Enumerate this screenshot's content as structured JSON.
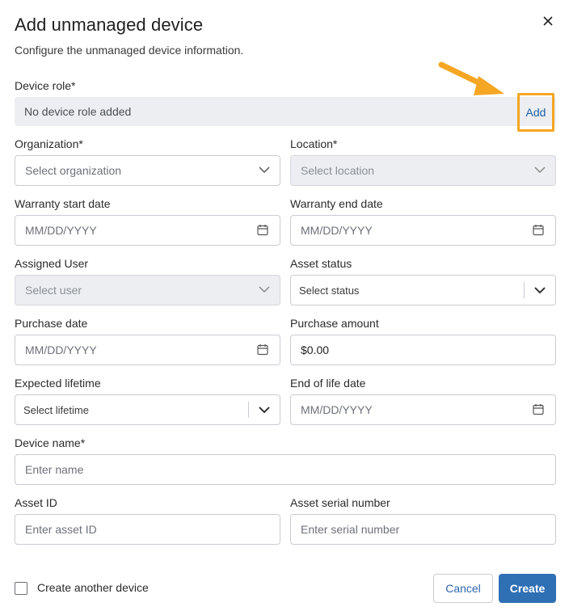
{
  "dialog": {
    "title": "Add unmanaged device",
    "subtitle": "Configure the unmanaged device information."
  },
  "device_role": {
    "label": "Device role*",
    "empty_text": "No device role added",
    "add_label": "Add"
  },
  "organization": {
    "label": "Organization*",
    "placeholder": "Select organization"
  },
  "location": {
    "label": "Location*",
    "placeholder": "Select location"
  },
  "warranty_start": {
    "label": "Warranty start date",
    "placeholder": "MM/DD/YYYY"
  },
  "warranty_end": {
    "label": "Warranty end date",
    "placeholder": "MM/DD/YYYY"
  },
  "assigned_user": {
    "label": "Assigned User",
    "placeholder": "Select user"
  },
  "asset_status": {
    "label": "Asset status",
    "placeholder": "Select status"
  },
  "purchase_date": {
    "label": "Purchase date",
    "placeholder": "MM/DD/YYYY"
  },
  "purchase_amount": {
    "label": "Purchase amount",
    "value": "$0.00"
  },
  "expected_lifetime": {
    "label": "Expected lifetime",
    "placeholder": "Select lifetime"
  },
  "end_of_life": {
    "label": "End of life date",
    "placeholder": "MM/DD/YYYY"
  },
  "device_name": {
    "label": "Device name*",
    "placeholder": "Enter name"
  },
  "asset_id": {
    "label": "Asset ID",
    "placeholder": "Enter asset ID"
  },
  "serial_number": {
    "label": "Asset serial number",
    "placeholder": "Enter serial number"
  },
  "footer": {
    "create_another_label": "Create another device",
    "cancel_label": "Cancel",
    "create_label": "Create"
  },
  "icons": {
    "close": "close-icon",
    "chevron": "chevron-down-icon",
    "calendar": "calendar-icon",
    "arrow": "annotation-arrow-icon"
  },
  "colors": {
    "accent": "#2f6fb4",
    "link": "#1f5fa8",
    "highlight": "#f5a623",
    "disabled_bg": "#eceef1"
  }
}
